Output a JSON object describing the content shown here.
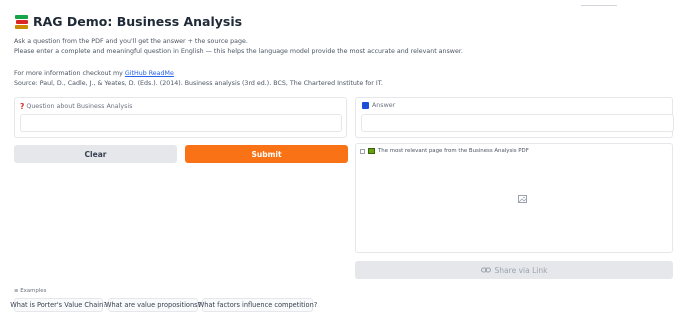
{
  "app": {
    "title": "RAG Demo: Business Analysis",
    "desc_line1": "Ask a question from the PDF and you'll get the answer + the source page.",
    "desc_line2": "Please enter a complete and meaningful question in English — this helps the language model provide the most accurate and relevant answer.",
    "more_info_prefix": "For more information checkout my ",
    "readme_link": "GitHub ReadMe",
    "source": "Source: Paul, D., Cadle, J., & Yeates, D. (Eds.). (2014). Business analysis (3rd ed.). BCS, The Chartered Institute for IT."
  },
  "question": {
    "label": "Question about Business Analysis",
    "value": "",
    "icon": "question-mark-icon"
  },
  "answer": {
    "label": "Answer",
    "value": "",
    "icon": "answer-square-icon"
  },
  "buttons": {
    "clear": "Clear",
    "submit": "Submit",
    "share": "Share via Link"
  },
  "image_output": {
    "label": "The most relevant page from the Business Analysis PDF",
    "placeholder_icon": "image-placeholder-icon"
  },
  "examples": {
    "label": "Examples",
    "items": [
      "What is Porter's Value Chain?",
      "What are value propositions?",
      "What factors influence competition?"
    ]
  },
  "colors": {
    "accent": "#f97316",
    "link": "#2563eb",
    "answer_icon": "#1d4ed8"
  }
}
